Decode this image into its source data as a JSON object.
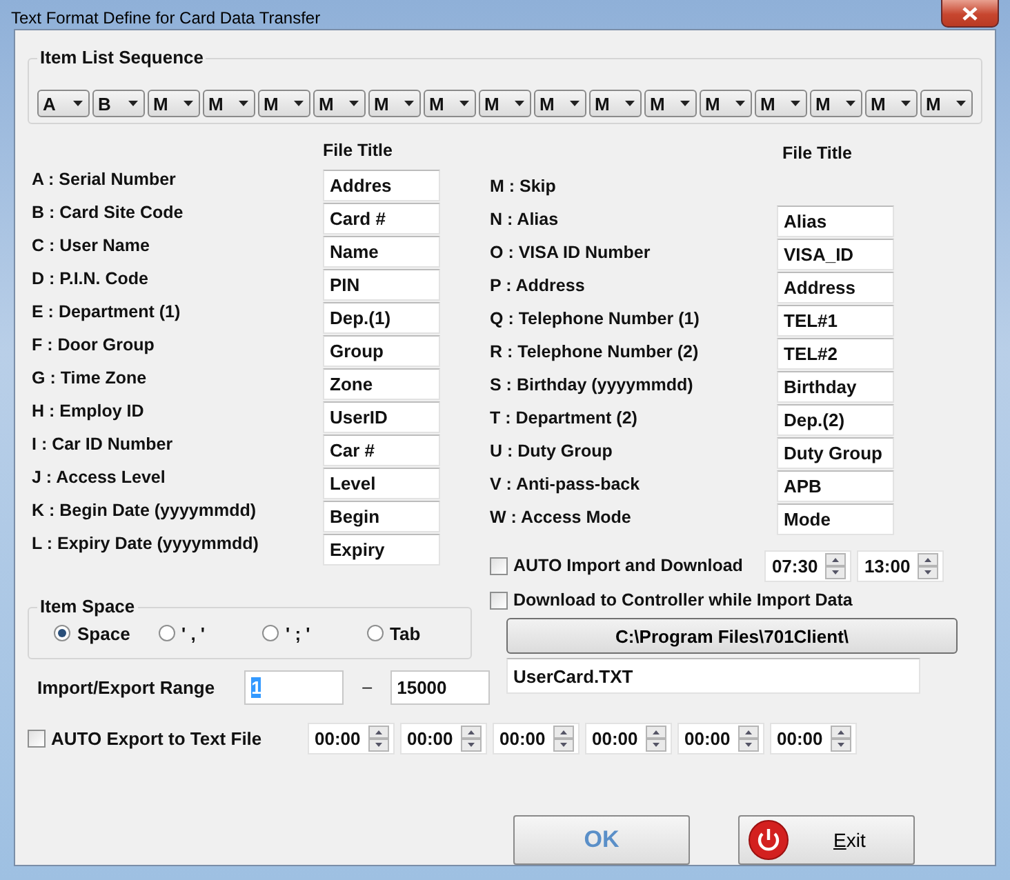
{
  "window": {
    "title": "Text Format Define for Card Data Transfer"
  },
  "item_list_sequence": {
    "label": "Item List Sequence",
    "slots": [
      "A",
      "B",
      "M",
      "M",
      "M",
      "M",
      "M",
      "M",
      "M",
      "M",
      "M",
      "M",
      "M",
      "M",
      "M",
      "M",
      "M"
    ]
  },
  "left_items": {
    "header": "File Title",
    "items": [
      {
        "label": "A : Serial Number",
        "file_title": "Addres"
      },
      {
        "label": "B : Card Site Code",
        "file_title": "Card #"
      },
      {
        "label": "C : User Name",
        "file_title": "Name"
      },
      {
        "label": "D : P.I.N. Code",
        "file_title": "PIN"
      },
      {
        "label": "E : Department (1)",
        "file_title": "Dep.(1)"
      },
      {
        "label": "F : Door Group",
        "file_title": "Group"
      },
      {
        "label": "G : Time Zone",
        "file_title": "Zone"
      },
      {
        "label": "H : Employ ID",
        "file_title": "UserID"
      },
      {
        "label": "I  : Car ID Number",
        "file_title": "Car #"
      },
      {
        "label": "J : Access Level",
        "file_title": "Level"
      },
      {
        "label": "K : Begin Date (yyyymmdd)",
        "file_title": "Begin"
      },
      {
        "label": "L : Expiry Date (yyyymmdd)",
        "file_title": "Expiry"
      }
    ]
  },
  "right_items": {
    "header": "File Title",
    "items": [
      {
        "label": "M : Skip"
      },
      {
        "label": "N : Alias",
        "file_title": "Alias"
      },
      {
        "label": "O : VISA ID Number",
        "file_title": "VISA_ID"
      },
      {
        "label": "P : Address",
        "file_title": "Address"
      },
      {
        "label": "Q : Telephone Number (1)",
        "file_title": "TEL#1"
      },
      {
        "label": "R : Telephone Number (2)",
        "file_title": "TEL#2"
      },
      {
        "label": "S : Birthday  (yyyymmdd)",
        "file_title": "Birthday"
      },
      {
        "label": "T : Department (2)",
        "file_title": "Dep.(2)"
      },
      {
        "label": "U : Duty Group",
        "file_title": "Duty Group"
      },
      {
        "label": "V : Anti-pass-back",
        "file_title": "APB"
      },
      {
        "label": "W : Access Mode",
        "file_title": "Mode"
      }
    ]
  },
  "item_space": {
    "label": "Item Space",
    "options": [
      {
        "label": "Space",
        "selected": true
      },
      {
        "label": "' , '",
        "selected": false
      },
      {
        "label": "' ; '",
        "selected": false
      },
      {
        "label": "Tab",
        "selected": false
      }
    ]
  },
  "range": {
    "label": "Import/Export Range",
    "from": "1",
    "from_selected": true,
    "separator": "–",
    "to": "15000"
  },
  "auto_import": {
    "label": "AUTO Import and Download",
    "checked": false,
    "times": [
      "07:30",
      "13:00"
    ]
  },
  "download_option": {
    "label": "Download to Controller while Import Data",
    "checked": false
  },
  "path_button": {
    "label": "C:\\Program Files\\701Client\\"
  },
  "file_name": {
    "value": "UserCard.TXT"
  },
  "auto_export": {
    "label": "AUTO Export to Text File",
    "checked": false,
    "times": [
      "00:00",
      "00:00",
      "00:00",
      "00:00",
      "00:00",
      "00:00"
    ]
  },
  "buttons": [
    {
      "kind": "ok",
      "label": "OK"
    },
    {
      "kind": "exit",
      "label": "Exit"
    }
  ]
}
